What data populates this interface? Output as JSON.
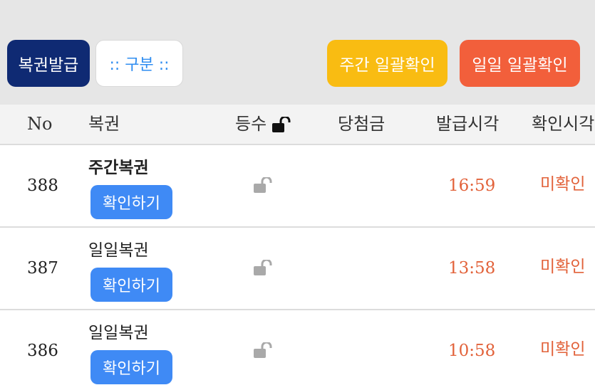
{
  "toolbar": {
    "issue_label": "복권발급",
    "category_select": ":: 구분 ::",
    "weekly_confirm_label": "주간 일괄확인",
    "daily_confirm_label": "일일 일괄확인"
  },
  "table": {
    "headers": {
      "no": "No",
      "ticket": "복권",
      "rank": "등수",
      "prize": "당첨금",
      "issued_time": "발급시각",
      "confirmed_time": "확인시각"
    },
    "rows": [
      {
        "no": "388",
        "ticket_type": "주간복권",
        "check_label": "확인하기",
        "rank_icon": "unlock-icon",
        "prize": "",
        "issued_time": "16:59",
        "status": "미확인"
      },
      {
        "no": "387",
        "ticket_type": "일일복권",
        "check_label": "확인하기",
        "rank_icon": "unlock-icon",
        "prize": "",
        "issued_time": "13:58",
        "status": "미확인"
      },
      {
        "no": "386",
        "ticket_type": "일일복권",
        "check_label": "확인하기",
        "rank_icon": "unlock-icon",
        "prize": "",
        "issued_time": "10:58",
        "status": "미확인"
      }
    ]
  },
  "colors": {
    "issue_button": "#0f2a73",
    "select_text": "#2f8df0",
    "weekly_button": "#f9bc12",
    "daily_button": "#f25f3b",
    "check_button": "#3f8af5",
    "status_text": "#e2623a"
  }
}
